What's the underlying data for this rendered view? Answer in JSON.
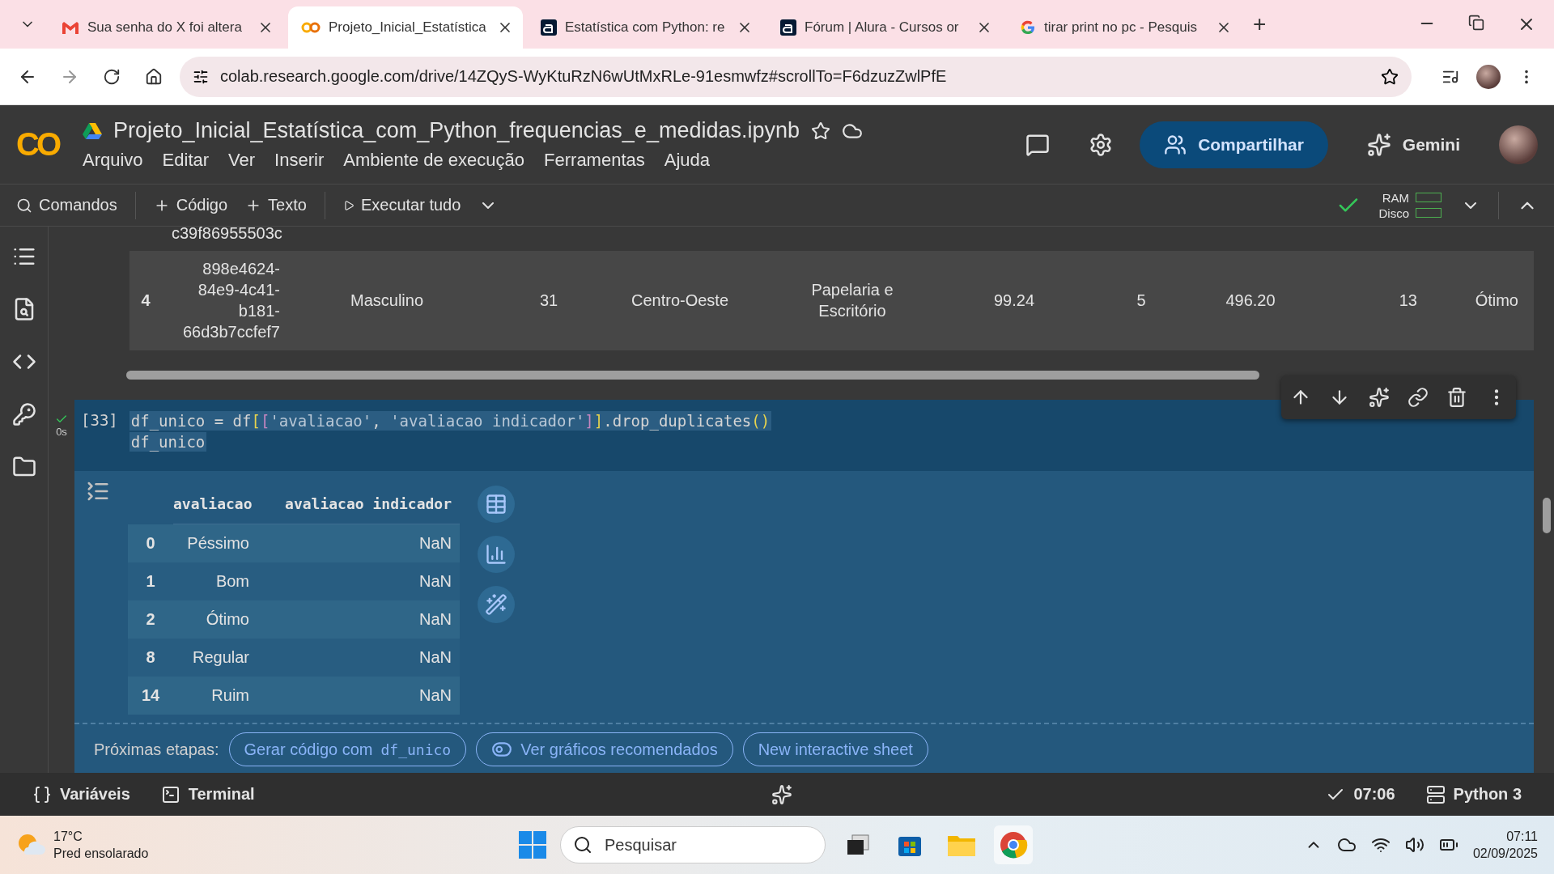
{
  "browser": {
    "tabs": [
      {
        "title": "Sua senha do X foi altera",
        "selected": false
      },
      {
        "title": "Projeto_Inicial_Estatística",
        "selected": true
      },
      {
        "title": "Estatística com Python: re",
        "selected": false
      },
      {
        "title": "Fórum | Alura - Cursos or",
        "selected": false
      },
      {
        "title": "tirar print no pc - Pesquis",
        "selected": false
      }
    ],
    "new_tab": "+",
    "url": "colab.research.google.com/drive/14ZQyS-WyKtuRzN6wUtMxRLe-91esmwfz#scrollTo=F6dzuzZwlPfE"
  },
  "notebook": {
    "logo": "CO",
    "title": "Projeto_Inicial_Estatística_com_Python_frequencias_e_medidas.ipynb",
    "menu": [
      "Arquivo",
      "Editar",
      "Ver",
      "Inserir",
      "Ambiente de execução",
      "Ferramentas",
      "Ajuda"
    ],
    "share": "Compartilhar",
    "gemini": "Gemini"
  },
  "toolbar": {
    "commands": "Comandos",
    "add_code": "Código",
    "add_text": "Texto",
    "run_all": "Executar tudo",
    "ram": "RAM",
    "disk": "Disco"
  },
  "previous_output": {
    "cut_text": "c39f86955503c",
    "row": {
      "index": "4",
      "cells": [
        "898e4624-84e9-4c41-b181-66d3b7ccfef7",
        "Masculino",
        "31",
        "Centro-Oeste",
        "Papelaria e Escritório",
        "99.24",
        "5",
        "496.20",
        "13",
        "Ótimo"
      ]
    }
  },
  "cell": {
    "count": "[33]",
    "time": "0s",
    "code_lines": [
      [
        {
          "text": "df_unico = df",
          "kind": "plain"
        },
        {
          "text": "[",
          "kind": "bracket-outer"
        },
        {
          "text": "[",
          "kind": "bracket-inner"
        },
        {
          "text": "'avaliacao'",
          "kind": "string"
        },
        {
          "text": ", ",
          "kind": "plain"
        },
        {
          "text": "'avaliacao indicador'",
          "kind": "string"
        },
        {
          "text": "]",
          "kind": "bracket-inner"
        },
        {
          "text": "]",
          "kind": "bracket-outer"
        },
        {
          "text": ".drop_duplicates",
          "kind": "plain"
        },
        {
          "text": "()",
          "kind": "paren"
        }
      ],
      [
        {
          "text": "df_unico",
          "kind": "plain"
        }
      ]
    ]
  },
  "output": {
    "columns": [
      "avaliacao",
      "avaliacao indicador"
    ],
    "rows": [
      {
        "index": "0",
        "cells": [
          "Péssimo",
          "NaN"
        ]
      },
      {
        "index": "1",
        "cells": [
          "Bom",
          "NaN"
        ]
      },
      {
        "index": "2",
        "cells": [
          "Ótimo",
          "NaN"
        ]
      },
      {
        "index": "8",
        "cells": [
          "Regular",
          "NaN"
        ]
      },
      {
        "index": "14",
        "cells": [
          "Ruim",
          "NaN"
        ]
      }
    ]
  },
  "next_steps": {
    "label": "Próximas etapas:",
    "buttons": [
      {
        "kind": "generate",
        "text": "Gerar código com",
        "code": "df_unico"
      },
      {
        "kind": "charts",
        "text": "Ver gráficos recomendados"
      },
      {
        "kind": "plain",
        "text": "New interactive sheet"
      }
    ]
  },
  "status_bar": {
    "variables": "Variáveis",
    "terminal": "Terminal",
    "time": "07:06",
    "runtime": "Python 3"
  },
  "taskbar": {
    "temperature": "17°C",
    "weather": "Pred ensolarado",
    "search_placeholder": "Pesquisar",
    "time": "07:11",
    "date": "02/09/2025"
  }
}
